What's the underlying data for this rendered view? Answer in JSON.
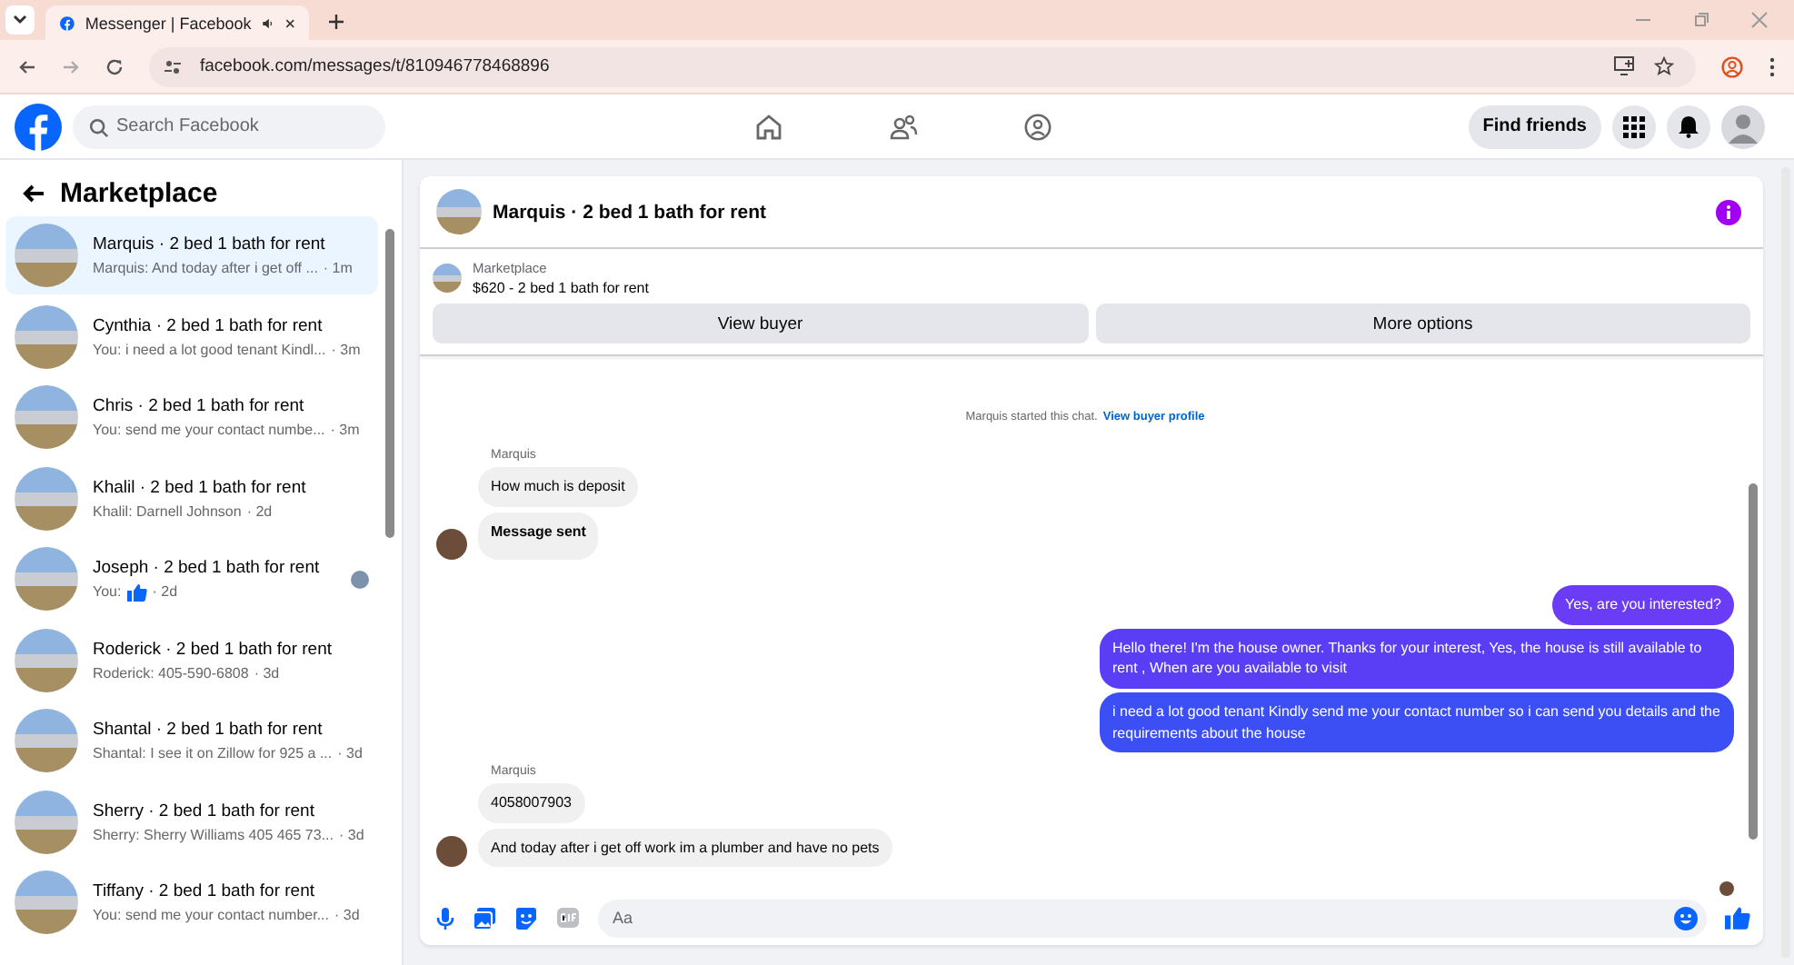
{
  "browser": {
    "tab_title": "Messenger | Facebook",
    "url": "facebook.com/messages/t/810946778468896"
  },
  "header": {
    "search": {
      "placeholder": "Search Facebook"
    },
    "find_friends": "Find friends"
  },
  "sidebar": {
    "title": "Marketplace",
    "conversations": [
      {
        "name": "Marquis · 2 bed 1 bath for rent",
        "preview": "Marquis: And today after i get off ...",
        "time": "· 1m",
        "selected": true,
        "kind": "text",
        "seen": false
      },
      {
        "name": "Cynthia · 2 bed 1 bath for rent",
        "preview": "You: i need a lot good tenant Kindl...",
        "time": "· 3m",
        "selected": false,
        "kind": "text",
        "seen": false
      },
      {
        "name": "Chris · 2 bed 1 bath for rent",
        "preview": "You: send me your contact numbe...",
        "time": "· 3m",
        "selected": false,
        "kind": "text",
        "seen": false
      },
      {
        "name": "Khalil · 2 bed 1 bath for rent",
        "preview": "Khalil: Darnell Johnson",
        "time": "· 2d",
        "selected": false,
        "kind": "text",
        "seen": false
      },
      {
        "name": "Joseph · 2 bed 1 bath for rent",
        "preview": "You:",
        "time": "· 2d",
        "selected": false,
        "kind": "like",
        "seen": true
      },
      {
        "name": "Roderick · 2 bed 1 bath for rent",
        "preview": "Roderick: 405-590-6808",
        "time": "· 3d",
        "selected": false,
        "kind": "text",
        "seen": false
      },
      {
        "name": "Shantal · 2 bed 1 bath for rent",
        "preview": "Shantal: I see it on Zillow for 925 a ...",
        "time": "· 3d",
        "selected": false,
        "kind": "text",
        "seen": false
      },
      {
        "name": "Sherry · 2 bed 1 bath for rent",
        "preview": "Sherry: Sherry Williams 405 465 73...",
        "time": "· 3d",
        "selected": false,
        "kind": "text",
        "seen": false
      },
      {
        "name": "Tiffany · 2 bed 1 bath for rent",
        "preview": "You: send me your contact number...",
        "time": "· 3d",
        "selected": false,
        "kind": "text",
        "seen": false
      }
    ]
  },
  "chat": {
    "title": "Marquis · 2 bed 1 bath for rent",
    "listing": {
      "label": "Marketplace",
      "detail": "$620 - 2 bed 1 bath for rent",
      "buttons": [
        "View buyer",
        "More options"
      ]
    },
    "messages": [
      {
        "kind": "system",
        "text": "Marquis started this chat.",
        "link": "View buyer profile"
      },
      {
        "kind": "incoming",
        "sender": "Marquis",
        "bubbles": [
          {
            "text": "How much is deposit",
            "bold": false
          },
          {
            "text": "Message sent",
            "bold": true
          }
        ]
      },
      {
        "kind": "outgoing",
        "bubbles": [
          {
            "text": "Yes, are you interested?",
            "bold": false
          },
          {
            "text": "Hello there! I'm the house owner. Thanks for your interest, Yes, the house is still available to rent , When are you available to visit",
            "bold": false
          },
          {
            "text": "i need a lot good tenant Kindly send me your contact number so i can send you details and the requirements about the house",
            "bold": false
          }
        ]
      },
      {
        "kind": "incoming",
        "sender": "Marquis",
        "bubbles": [
          {
            "text": "4058007903",
            "bold": false
          },
          {
            "text": "And today after i get off work im a plumber and have no pets",
            "bold": false
          }
        ]
      }
    ],
    "composer": {
      "placeholder": "Aa"
    }
  }
}
